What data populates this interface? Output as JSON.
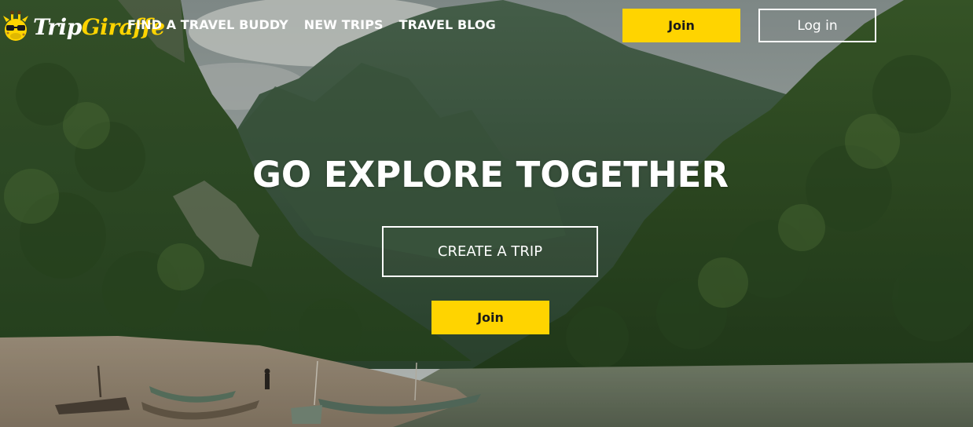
{
  "brand": {
    "name_part1": "Trip",
    "name_part2": "Giraffe",
    "accent_color": "#ffd400"
  },
  "nav": {
    "items": [
      {
        "label": "FIND A TRAVEL BUDDY"
      },
      {
        "label": "NEW TRIPS"
      },
      {
        "label": "TRAVEL BLOG"
      }
    ]
  },
  "header": {
    "join_label": "Join",
    "login_label": "Log in"
  },
  "hero": {
    "headline": "GO EXPLORE TOGETHER",
    "create_trip_label": "CREATE A TRIP",
    "join_label": "Join",
    "background": "river-valley-jungle-mountains-photo"
  }
}
